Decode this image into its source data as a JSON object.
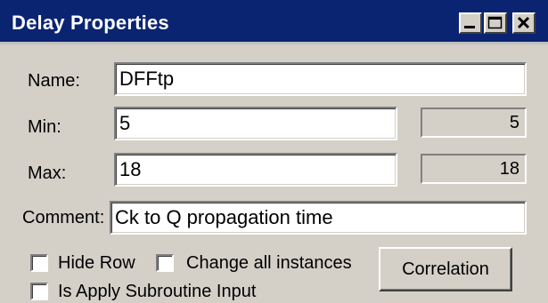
{
  "window": {
    "title": "Delay Properties",
    "controls": [
      "minimize-icon",
      "maximize-icon",
      "close-icon"
    ]
  },
  "form": {
    "name": {
      "label": "Name:",
      "value": "DFFtp"
    },
    "min": {
      "label": "Min:",
      "value": "5",
      "display": "5"
    },
    "max": {
      "label": "Max:",
      "value": "18",
      "display": "18"
    },
    "comment": {
      "label": "Comment:",
      "value": "Ck to Q propagation time"
    }
  },
  "options": {
    "hide_row": {
      "label": "Hide Row",
      "checked": false
    },
    "change_all": {
      "label": "Change all instances",
      "checked": false
    },
    "apply_subroutine": {
      "label": "Is Apply Subroutine Input",
      "checked": false
    }
  },
  "buttons": {
    "correlation": "Correlation"
  },
  "colors": {
    "titlebar": "#0b2472",
    "face": "#d4d0c8"
  }
}
